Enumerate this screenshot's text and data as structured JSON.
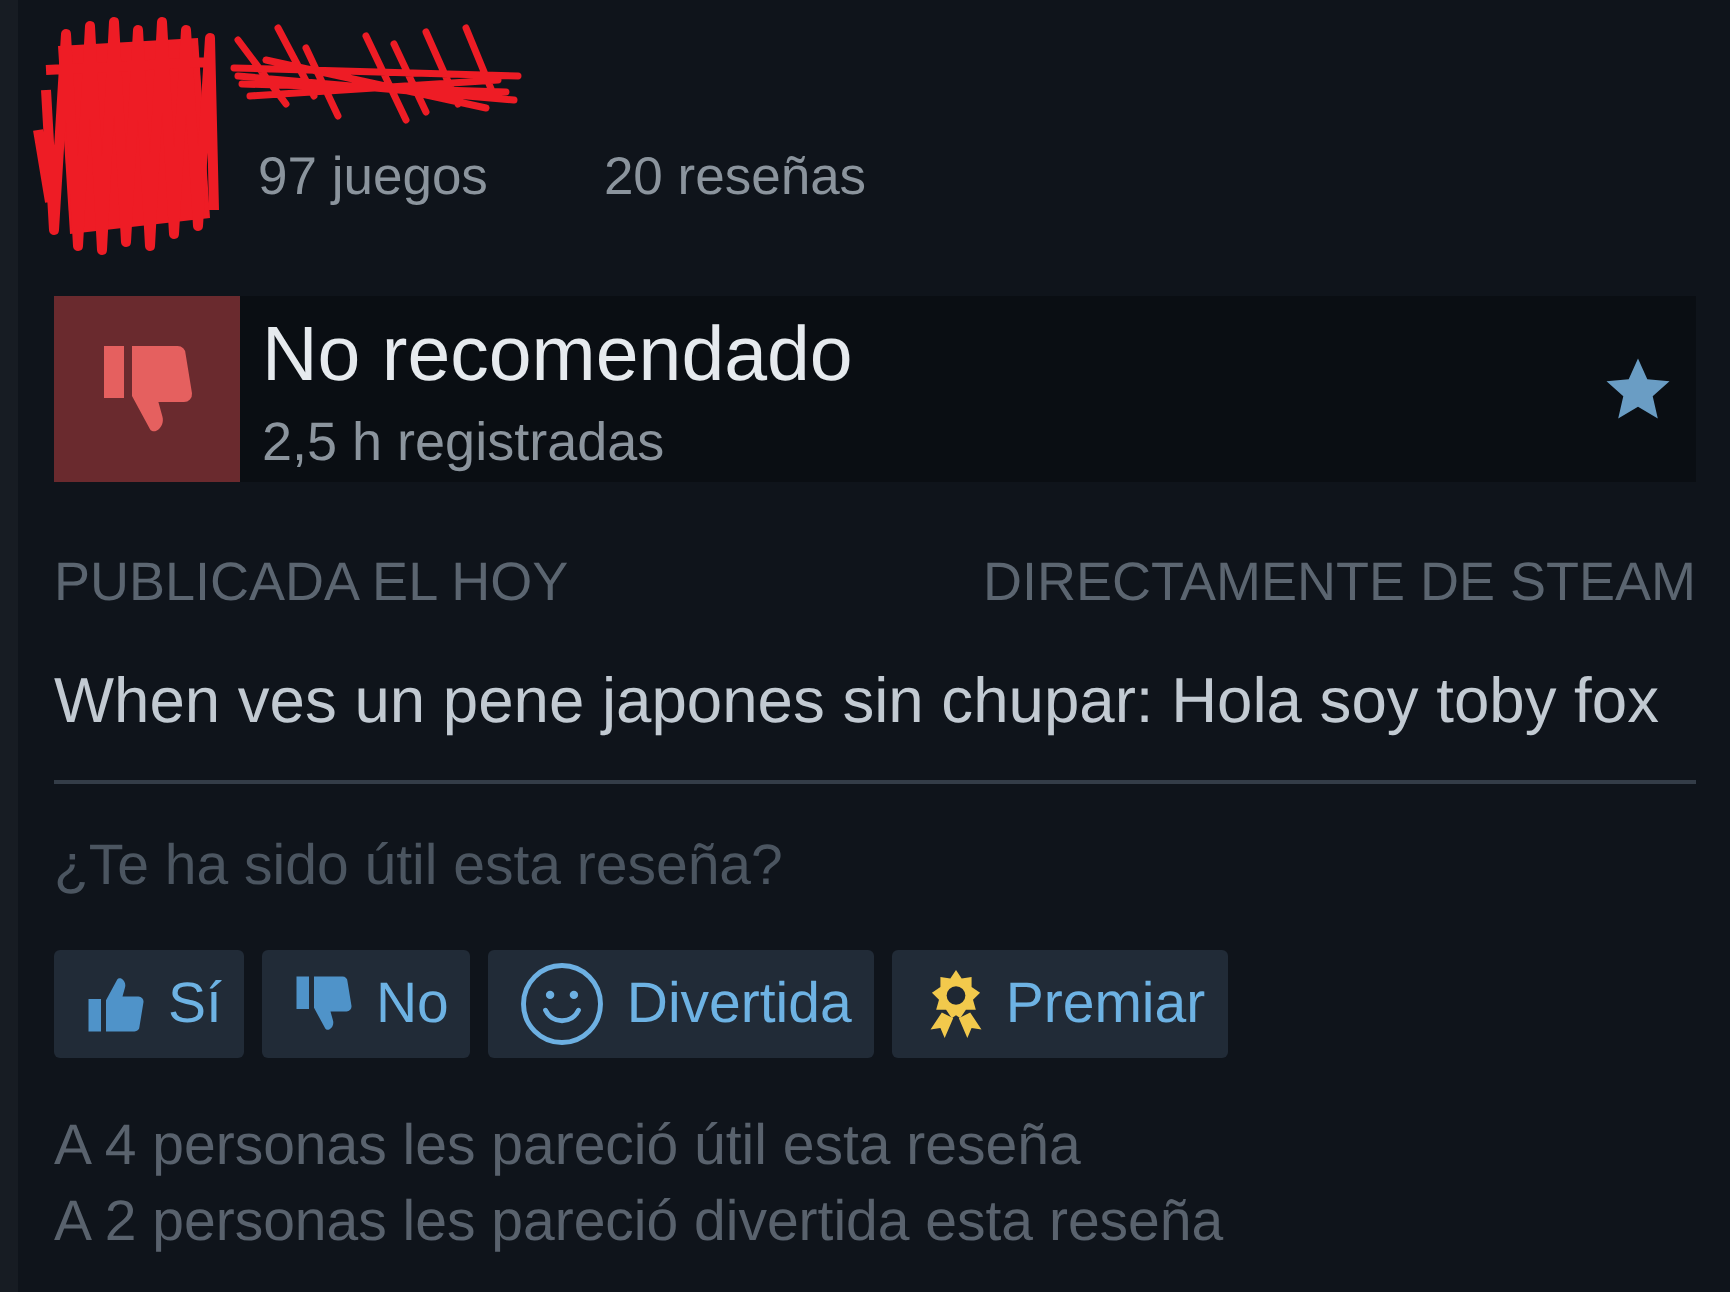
{
  "profile": {
    "games": "97 juegos",
    "reviews": "20 reseñas"
  },
  "recommendation": {
    "verdict": "No recomendado",
    "recommended": false,
    "hours": "2,5 h registradas"
  },
  "meta": {
    "posted": "PUBLICADA EL HOY",
    "source": "DIRECTAMENTE DE STEAM"
  },
  "review": {
    "text": "When ves un pene japones sin chupar: Hola soy toby fox"
  },
  "feedback": {
    "question": "¿Te ha sido útil esta reseña?",
    "buttons": [
      {
        "kind": "yes",
        "label": "Sí"
      },
      {
        "kind": "no",
        "label": "No"
      },
      {
        "kind": "funny",
        "label": "Divertida"
      },
      {
        "kind": "award",
        "label": "Premiar"
      }
    ]
  },
  "tallies": [
    "A 4 personas les pareció útil esta reseña",
    "A 2 personas les pareció divertida esta reseña"
  ]
}
